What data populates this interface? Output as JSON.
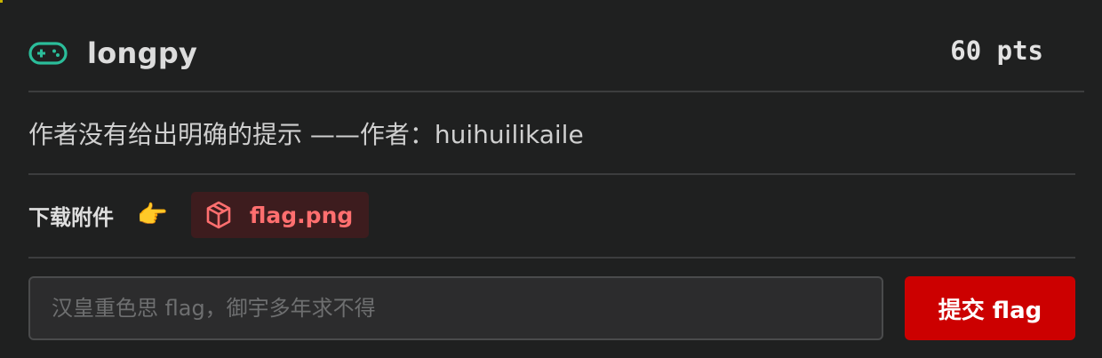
{
  "challenge": {
    "title": "longpy",
    "points": "60 pts",
    "icon": "gamepad-icon",
    "accent_color": "#2bbd9a"
  },
  "description": "作者没有给出明确的提示 ——作者：huihuilikaile",
  "download": {
    "label": "下载附件",
    "pointer_icon": "👉",
    "attachment_icon": "package-icon",
    "attachment_name": "flag.png",
    "attachment_color": "#ff6f6f",
    "attachment_bg": "#3d1c1e"
  },
  "submit": {
    "placeholder": "汉皇重色思 flag，御宇多年求不得",
    "value": "",
    "button_label": "提交 flag",
    "button_color": "#cc0000"
  }
}
